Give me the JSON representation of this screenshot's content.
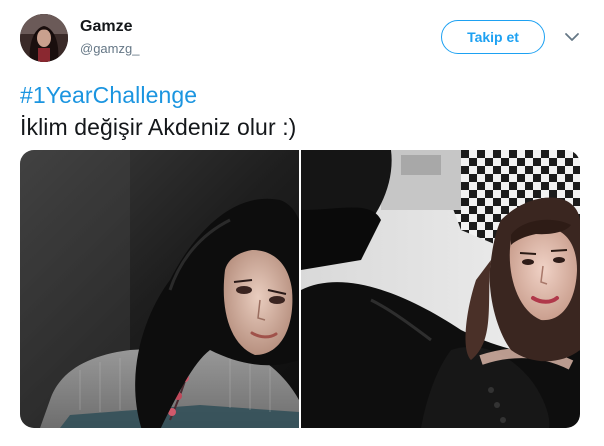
{
  "tweet": {
    "author": {
      "display_name": "Gamze",
      "handle": "@gamzg_"
    },
    "follow_label": "Takip et",
    "more_icon": "chevron-down-icon",
    "hashtag": "#1YearChallenge",
    "text": "İklim değişir Akdeniz olur :)",
    "media_count": 2
  },
  "colors": {
    "accent": "#1da1f2",
    "link": "#1b95e0",
    "text": "#14171a",
    "secondary": "#657786"
  }
}
